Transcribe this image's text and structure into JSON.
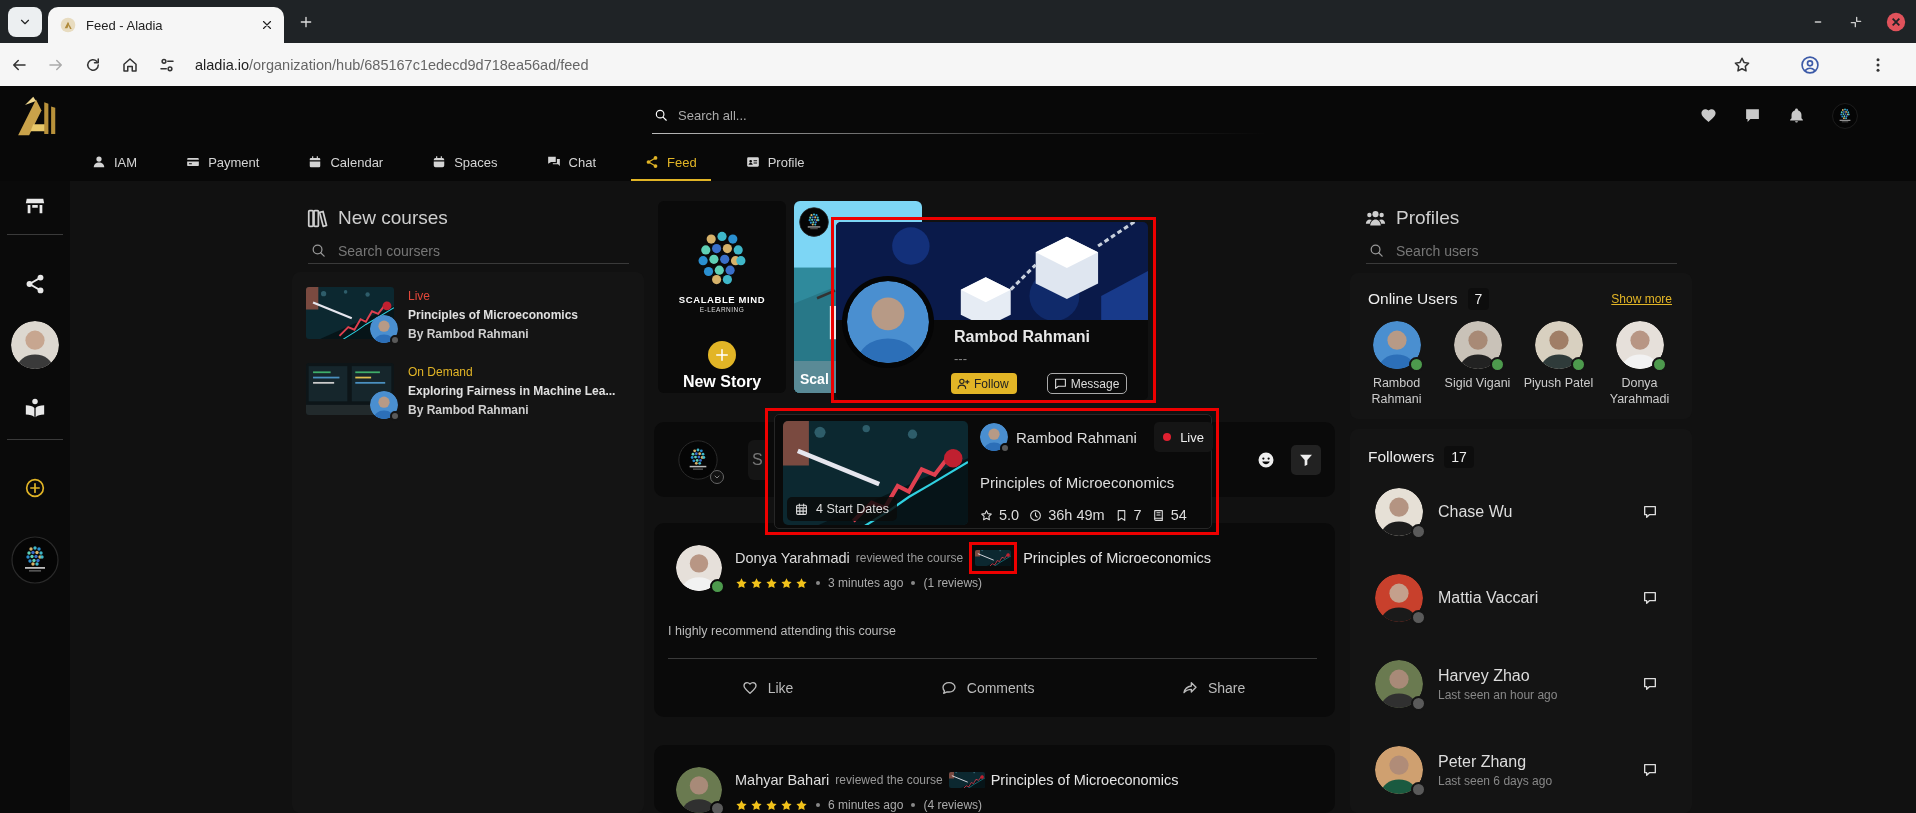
{
  "browser": {
    "tab_title": "Feed - Aladia",
    "url_host": "aladia.io",
    "url_path": "/organization/hub/685167c1edecd9d718ea56ad/feed",
    "forward_disabled": true
  },
  "header": {
    "search_placeholder": "Search all..."
  },
  "nav_tabs": [
    {
      "label": "IAM",
      "selected": false
    },
    {
      "label": "Payment",
      "selected": false
    },
    {
      "label": "Calendar",
      "selected": false
    },
    {
      "label": "Spaces",
      "selected": false
    },
    {
      "label": "Chat",
      "selected": false
    },
    {
      "label": "Feed",
      "selected": true
    },
    {
      "label": "Profile",
      "selected": false
    }
  ],
  "new_courses": {
    "title": "New courses",
    "search_placeholder": "Search coursers",
    "items": [
      {
        "status": "Live",
        "kind": "live",
        "title": "Principles of Microeconomics",
        "author": "By Rambod Rahmani",
        "author_online": false
      },
      {
        "status": "On Demand",
        "kind": "on_demand",
        "title": "Exploring Fairness in Machine Lea...",
        "author": "By Rambod Rahmani",
        "author_online": false
      }
    ]
  },
  "stories": [
    {
      "kind": "new",
      "brand": "SCALABLE MIND",
      "brand_tagline": "E-LEARNING",
      "label": "New Story"
    },
    {
      "kind": "story",
      "label": "Scal"
    }
  ],
  "profile_popup": {
    "highlighted": true,
    "name": "Rambod Rahmani",
    "subtitle": "---",
    "follow": "Follow",
    "message": "Message"
  },
  "composer": {
    "placeholder": "S"
  },
  "course_popup": {
    "highlighted": true,
    "start_dates": "4 Start Dates",
    "author": "Rambod Rahmani",
    "author_online": false,
    "status": "Live",
    "title": "Principles of Microeconomics",
    "rating": "5.0",
    "duration": "36h 49m",
    "saves": "7",
    "lessons": "54"
  },
  "posts": [
    {
      "author": "Donya Yarahmadi",
      "author_online": true,
      "action": "reviewed the course",
      "course": "Principles of Microeconomics",
      "thumb_highlighted": true,
      "stars": 5,
      "time": "3 minutes ago",
      "reviews": "(1 reviews)",
      "body": "I highly recommend attending this course",
      "actions": [
        "Like",
        "Comments",
        "Share"
      ]
    },
    {
      "author": "Mahyar Bahari",
      "author_online": false,
      "action": "reviewed the course",
      "course": "Principles of Microeconomics",
      "thumb_highlighted": false,
      "stars": 5,
      "time": "6 minutes ago",
      "reviews": "(4 reviews)"
    }
  ],
  "profiles": {
    "title": "Profiles",
    "search_placeholder": "Search users"
  },
  "online_users": {
    "title": "Online Users",
    "count": "7",
    "show_more": "Show more",
    "items": [
      {
        "name": "Rambod Rahmani",
        "online": true
      },
      {
        "name": "Sigid Vigani",
        "online": true
      },
      {
        "name": "Piyush Patel",
        "online": true
      },
      {
        "name": "Donya Yarahmadi",
        "online": true
      }
    ]
  },
  "followers": {
    "title": "Followers",
    "count": "17",
    "items": [
      {
        "name": "Chase Wu",
        "online": false
      },
      {
        "name": "Mattia Vaccari",
        "online": false
      },
      {
        "name": "Harvey Zhao",
        "last_seen": "Last seen an hour ago",
        "online": false
      },
      {
        "name": "Peter Zhang",
        "last_seen": "Last seen 6 days ago",
        "online": false
      }
    ]
  }
}
